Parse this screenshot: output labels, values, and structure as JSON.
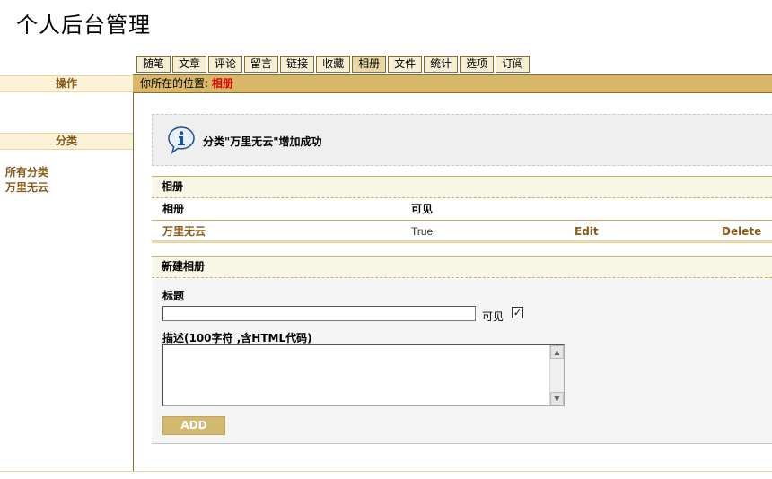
{
  "page": {
    "title": "个人后台管理"
  },
  "nav": {
    "tabs": [
      {
        "label": "随笔"
      },
      {
        "label": "文章"
      },
      {
        "label": "评论"
      },
      {
        "label": "留言"
      },
      {
        "label": "链接"
      },
      {
        "label": "收藏"
      },
      {
        "label": "相册",
        "active": true
      },
      {
        "label": "文件"
      },
      {
        "label": "统计"
      },
      {
        "label": "选项"
      },
      {
        "label": "订阅"
      }
    ]
  },
  "sidebar": {
    "operations_heading": "操作",
    "categories_heading": "分类",
    "links": [
      {
        "label": "所有分类"
      },
      {
        "label": "万里无云"
      }
    ]
  },
  "location": {
    "prefix": "你所在的位置:",
    "current": "相册"
  },
  "message": {
    "icon": "info-icon",
    "text": "分类\"万里无云\"增加成功"
  },
  "albums": {
    "heading": "相册",
    "columns": [
      "相册",
      "可见"
    ],
    "rows": [
      {
        "name": "万里无云",
        "visible": "True",
        "edit": "Edit",
        "delete": "Delete"
      }
    ]
  },
  "new_album": {
    "heading": "新建相册",
    "title_label": "标题",
    "title_value": "",
    "visible_label": "可见",
    "visible_checked": true,
    "description_label": "描述(100字符 ,含HTML代码)",
    "description_value": "",
    "submit_label": "ADD"
  },
  "colors": {
    "location_bar": "#d8b868",
    "accent_brown": "#8a5a18",
    "current_location": "#e00000",
    "button": "#d2b870"
  }
}
